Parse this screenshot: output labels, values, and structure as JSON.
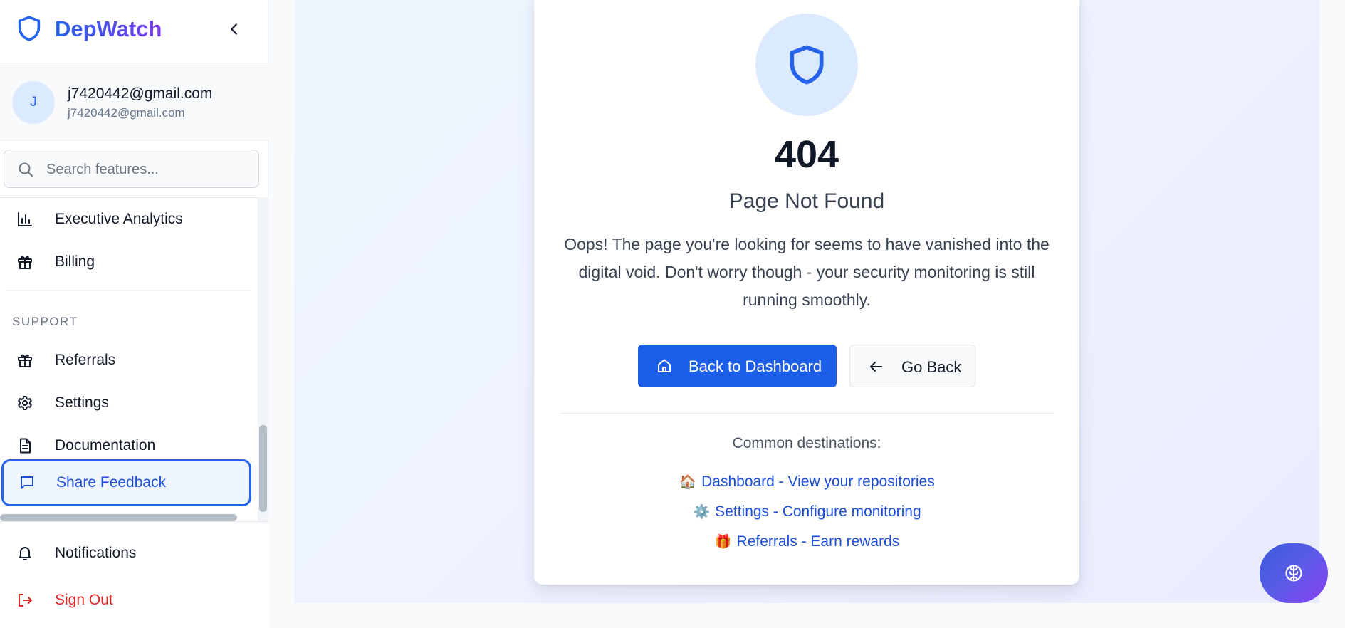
{
  "app": {
    "name": "DepWatch"
  },
  "user": {
    "initial": "J",
    "name": "j7420442@gmail.com",
    "email": "j7420442@gmail.com"
  },
  "search": {
    "placeholder": "Search features..."
  },
  "sidebar": {
    "items": [
      {
        "label": "Executive Analytics",
        "icon": "bar-chart-icon"
      },
      {
        "label": "Billing",
        "icon": "gift-icon"
      }
    ],
    "support_section": {
      "title": "SUPPORT",
      "items": [
        {
          "label": "Referrals",
          "icon": "gift-icon"
        },
        {
          "label": "Settings",
          "icon": "gear-icon"
        },
        {
          "label": "Documentation",
          "icon": "document-icon"
        },
        {
          "label": "Share Feedback",
          "icon": "message-icon",
          "active": true
        }
      ]
    },
    "bottom": [
      {
        "label": "Notifications",
        "icon": "bell-icon"
      },
      {
        "label": "Sign Out",
        "icon": "sign-out-icon"
      }
    ]
  },
  "error": {
    "code": "404",
    "title": "Page Not Found",
    "message": "Oops! The page you're looking for seems to have vanished into the digital void. Don't worry though - your security monitoring is still running smoothly."
  },
  "actions": {
    "primary": {
      "label": "Back to Dashboard",
      "icon": "home-icon"
    },
    "secondary": {
      "label": "Go Back",
      "icon": "arrow-left-icon"
    }
  },
  "destinations": {
    "title": "Common destinations:",
    "links": [
      {
        "emoji": "🏠",
        "label": "Dashboard - View your repositories"
      },
      {
        "emoji": "⚙️",
        "label": "Settings - Configure monitoring"
      },
      {
        "emoji": "🎁",
        "label": "Referrals - Earn rewards"
      }
    ]
  },
  "colors": {
    "primary": "#1d5ee8",
    "link": "#1d4ed8",
    "danger": "#dc2626",
    "brand_gradient_start": "#2563eb",
    "brand_gradient_end": "#7c3aed"
  },
  "fab": {
    "icon": "brain-icon"
  }
}
